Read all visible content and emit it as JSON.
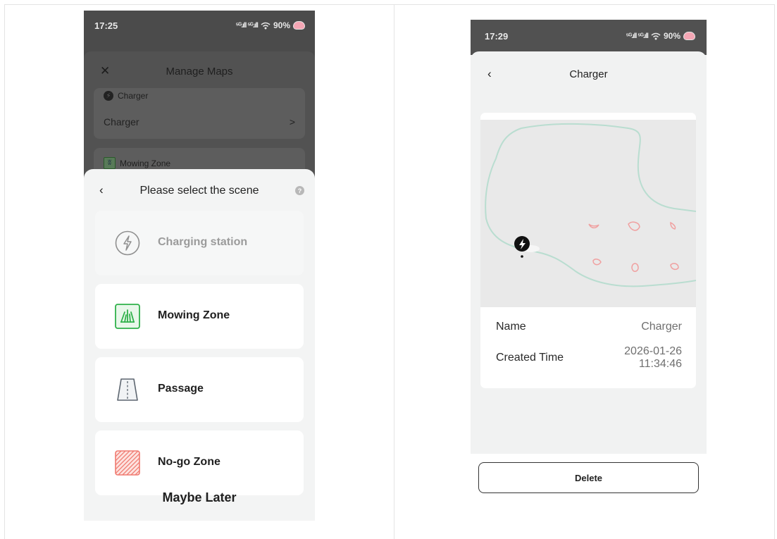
{
  "left": {
    "status": {
      "time": "17:25",
      "signal": "⁵ᴳ.ıll ⁵ᴳ.ıll",
      "wifi": "wifi-icon",
      "battery": "90%"
    },
    "manage": {
      "title": "Manage Maps",
      "close_icon": "close-icon",
      "charger_section": "Charger",
      "charger_row": "Charger",
      "chevron": ">",
      "mowing_section": "Mowing Zone"
    },
    "sheet": {
      "title": "Please select the scene",
      "back_icon": "chevron-left-icon",
      "help_icon": "question-icon",
      "options": [
        {
          "label": "Charging station",
          "icon": "lightning-circle-icon",
          "disabled": true
        },
        {
          "label": "Mowing Zone",
          "icon": "grass-icon",
          "disabled": false
        },
        {
          "label": "Passage",
          "icon": "road-icon",
          "disabled": false
        },
        {
          "label": "No-go Zone",
          "icon": "hatched-square-icon",
          "disabled": false
        }
      ],
      "maybe_later": "Maybe Later"
    }
  },
  "right": {
    "status": {
      "time": "17:29",
      "signal": "⁵ᴳ.ıll ⁵ᴳ.ıll",
      "wifi": "wifi-icon",
      "battery": "90%"
    },
    "title": "Charger",
    "info": {
      "name_label": "Name",
      "name_value": "Charger",
      "created_label": "Created Time",
      "created_date": "2026-01-26",
      "created_time": "11:34:46"
    },
    "delete_label": "Delete",
    "colors": {
      "boundary": "#b9ddd0",
      "nogo": "#f0a0a0",
      "map_bg": "#e9e9e9"
    }
  }
}
